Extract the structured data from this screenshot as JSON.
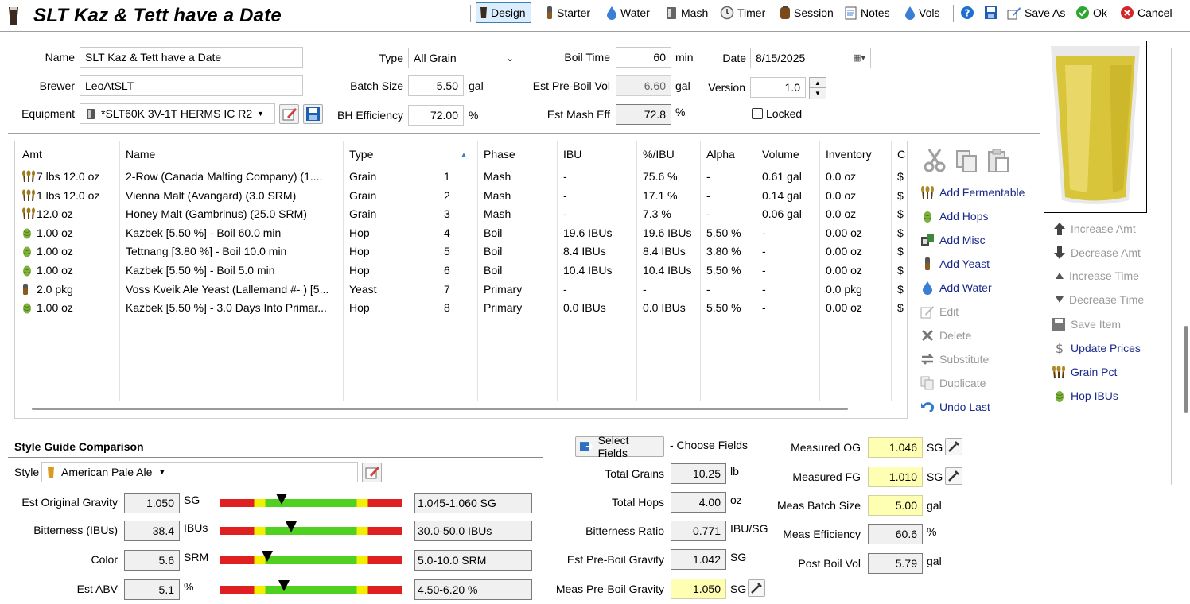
{
  "window": {
    "title": "SLT Kaz & Tett have a Date"
  },
  "toolbar": {
    "design": "Design",
    "starter": "Starter",
    "water": "Water",
    "mash": "Mash",
    "timer": "Timer",
    "session": "Session",
    "notes": "Notes",
    "vols": "Vols",
    "save_as": "Save As",
    "ok": "Ok",
    "cancel": "Cancel"
  },
  "recipe": {
    "name_label": "Name",
    "name_value": "SLT Kaz & Tett have a Date",
    "brewer_label": "Brewer",
    "brewer_value": "LeoAtSLT",
    "equipment_label": "Equipment",
    "equipment_value": "*SLT60K 3V-1T HERMS IC R2",
    "type_label": "Type",
    "type_value": "All Grain",
    "batch_size_label": "Batch Size",
    "batch_size_value": "5.50",
    "batch_size_unit": "gal",
    "bh_eff_label": "BH Efficiency",
    "bh_eff_value": "72.00",
    "bh_eff_unit": "%",
    "boil_time_label": "Boil Time",
    "boil_time_value": "60",
    "boil_time_unit": "min",
    "pre_boil_label": "Est Pre-Boil Vol",
    "pre_boil_value": "6.60",
    "pre_boil_unit": "gal",
    "mash_eff_label": "Est Mash Eff",
    "mash_eff_value": "72.8",
    "mash_eff_unit": "%",
    "date_label": "Date",
    "date_value": "8/15/2025",
    "version_label": "Version",
    "version_value": "1.0",
    "locked_label": "Locked"
  },
  "table": {
    "headers": [
      "Amt",
      "Name",
      "Type",
      "",
      "Phase",
      "IBU",
      "%/IBU",
      "Alpha",
      "Volume",
      "Inventory",
      "C"
    ],
    "rows": [
      {
        "icon": "grain",
        "amt": "7 lbs 12.0 oz",
        "name": "2-Row (Canada Malting Company) (1....",
        "type": "Grain",
        "num": "1",
        "phase": "Mash",
        "ibu": "-",
        "pct": "75.6 %",
        "alpha": "-",
        "volume": "0.61 gal",
        "inventory": "0.0 oz",
        "cost": "$"
      },
      {
        "icon": "grain",
        "amt": "1 lbs 12.0 oz",
        "name": "Vienna Malt (Avangard) (3.0 SRM)",
        "type": "Grain",
        "num": "2",
        "phase": "Mash",
        "ibu": "-",
        "pct": "17.1 %",
        "alpha": "-",
        "volume": "0.14 gal",
        "inventory": "0.0 oz",
        "cost": "$"
      },
      {
        "icon": "grain",
        "amt": "12.0 oz",
        "name": "Honey Malt (Gambrinus) (25.0 SRM)",
        "type": "Grain",
        "num": "3",
        "phase": "Mash",
        "ibu": "-",
        "pct": "7.3 %",
        "alpha": "-",
        "volume": "0.06 gal",
        "inventory": "0.0 oz",
        "cost": "$"
      },
      {
        "icon": "hop",
        "amt": "1.00 oz",
        "name": "Kazbek [5.50 %] - Boil 60.0 min",
        "type": "Hop",
        "num": "4",
        "phase": "Boil",
        "ibu": "19.6 IBUs",
        "pct": "19.6 IBUs",
        "alpha": "5.50 %",
        "volume": "-",
        "inventory": "0.00 oz",
        "cost": "$"
      },
      {
        "icon": "hop",
        "amt": "1.00 oz",
        "name": "Tettnang [3.80 %] - Boil 10.0 min",
        "type": "Hop",
        "num": "5",
        "phase": "Boil",
        "ibu": "8.4 IBUs",
        "pct": "8.4 IBUs",
        "alpha": "3.80 %",
        "volume": "-",
        "inventory": "0.00 oz",
        "cost": "$"
      },
      {
        "icon": "hop",
        "amt": "1.00 oz",
        "name": "Kazbek [5.50 %] - Boil 5.0 min",
        "type": "Hop",
        "num": "6",
        "phase": "Boil",
        "ibu": "10.4 IBUs",
        "pct": "10.4 IBUs",
        "alpha": "5.50 %",
        "volume": "-",
        "inventory": "0.00 oz",
        "cost": "$"
      },
      {
        "icon": "yeast",
        "amt": "2.0 pkg",
        "name": "Voss Kveik Ale Yeast (Lallemand #- ) [5...",
        "type": "Yeast",
        "num": "7",
        "phase": "Primary",
        "ibu": "-",
        "pct": "-",
        "alpha": "-",
        "volume": "-",
        "inventory": "0.0 pkg",
        "cost": "$"
      },
      {
        "icon": "hop",
        "amt": "1.00 oz",
        "name": "Kazbek [5.50 %] - 3.0 Days Into Primar...",
        "type": "Hop",
        "num": "8",
        "phase": "Primary",
        "ibu": "0.0 IBUs",
        "pct": "0.0 IBUs",
        "alpha": "5.50 %",
        "volume": "-",
        "inventory": "0.00 oz",
        "cost": "$"
      }
    ]
  },
  "ingredient_actions": {
    "add_fermentable": "Add Fermentable",
    "add_hops": "Add Hops",
    "add_misc": "Add Misc",
    "add_yeast": "Add Yeast",
    "add_water": "Add Water",
    "edit": "Edit",
    "delete": "Delete",
    "substitute": "Substitute",
    "duplicate": "Duplicate",
    "undo_last": "Undo Last"
  },
  "amount_actions": {
    "increase_amt": "Increase Amt",
    "decrease_amt": "Decrease Amt",
    "increase_time": "Increase Time",
    "decrease_time": "Decrease Time",
    "save_item": "Save Item",
    "update_prices": "Update Prices",
    "grain_pct": "Grain Pct",
    "hop_ibus": "Hop IBUs"
  },
  "style_guide": {
    "title": "Style Guide Comparison",
    "style_label": "Style",
    "style_value": "American Pale Ale",
    "rows": [
      {
        "label": "Est Original Gravity",
        "value": "1.050",
        "unit": "SG",
        "range": "1.045-1.060 SG",
        "marker": 0.34
      },
      {
        "label": "Bitterness (IBUs)",
        "value": "38.4",
        "unit": "IBUs",
        "range": "30.0-50.0 IBUs",
        "marker": 0.39
      },
      {
        "label": "Color",
        "value": "5.6",
        "unit": "SRM",
        "range": "5.0-10.0 SRM",
        "marker": 0.26
      },
      {
        "label": "Est ABV",
        "value": "5.1",
        "unit": "%",
        "range": "4.50-6.20 %",
        "marker": 0.35
      }
    ]
  },
  "fields": {
    "select_fields": "Select Fields",
    "choose_fields": "- Choose Fields",
    "total_grains_label": "Total Grains",
    "total_grains_value": "10.25",
    "total_grains_unit": "lb",
    "total_hops_label": "Total Hops",
    "total_hops_value": "4.00",
    "total_hops_unit": "oz",
    "bitterness_ratio_label": "Bitterness Ratio",
    "bitterness_ratio_value": "0.771",
    "bitterness_ratio_unit": "IBU/SG",
    "pre_boil_gravity_label": "Est Pre-Boil Gravity",
    "pre_boil_gravity_value": "1.042",
    "pre_boil_gravity_unit": "SG",
    "meas_pre_boil_label": "Meas Pre-Boil Gravity",
    "meas_pre_boil_value": "1.050",
    "meas_pre_boil_unit": "SG"
  },
  "measured": {
    "og_label": "Measured OG",
    "og_value": "1.046",
    "og_unit": "SG",
    "fg_label": "Measured FG",
    "fg_value": "1.010",
    "fg_unit": "SG",
    "batch_label": "Meas Batch Size",
    "batch_value": "5.00",
    "batch_unit": "gal",
    "eff_label": "Meas Efficiency",
    "eff_value": "60.6",
    "eff_unit": "%",
    "post_boil_label": "Post Boil Vol",
    "post_boil_value": "5.79",
    "post_boil_unit": "gal"
  },
  "colors": {
    "beer": "#d9c53a",
    "highlight": "#ffffb3",
    "link": "#1a2a8a",
    "bar_red": "#e02020",
    "bar_yellow": "#f0f000",
    "bar_green": "#50d020"
  }
}
